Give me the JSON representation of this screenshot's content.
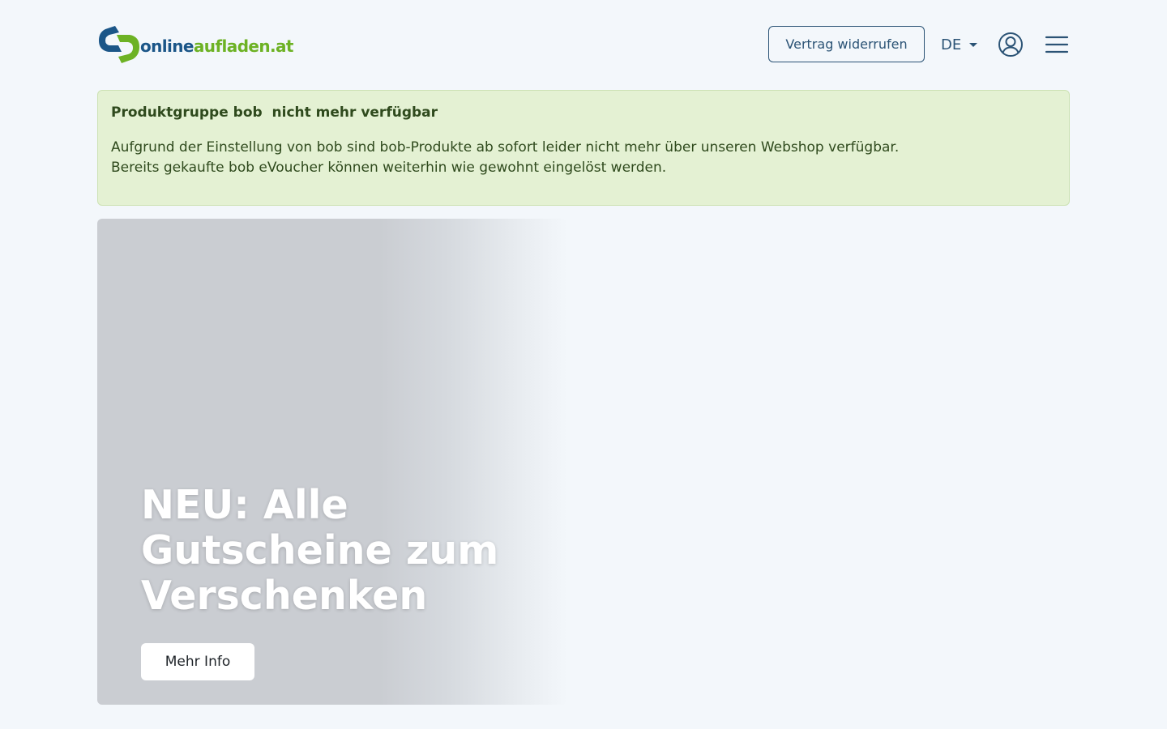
{
  "header": {
    "logo": {
      "text_part1": "online",
      "text_part2": "aufladen.at"
    },
    "revoke_button": "Vertrag widerrufen",
    "language": "DE",
    "icons": {
      "user": "user-circle-icon",
      "menu": "hamburger-menu-icon",
      "language_caret": "caret-down-icon"
    }
  },
  "alert": {
    "title": "Produktgruppe bob  nicht mehr verfügbar",
    "line1": "Aufgrund der Einstellung von bob sind bob-Produkte ab sofort leider nicht mehr über unseren Webshop verfügbar.",
    "line2": "Bereits gekaufte bob eVoucher können weiterhin wie gewohnt eingelöst werden."
  },
  "hero": {
    "title": "NEU: Alle Gutscheine zum Verschenken",
    "button": "Mehr Info"
  },
  "colors": {
    "background": "#f3f7fb",
    "brand_blue": "#1b5688",
    "brand_green": "#6db224",
    "alert_background": "#e4f1d3",
    "alert_text": "#2f4a1d",
    "nav_text": "#2b5375"
  }
}
